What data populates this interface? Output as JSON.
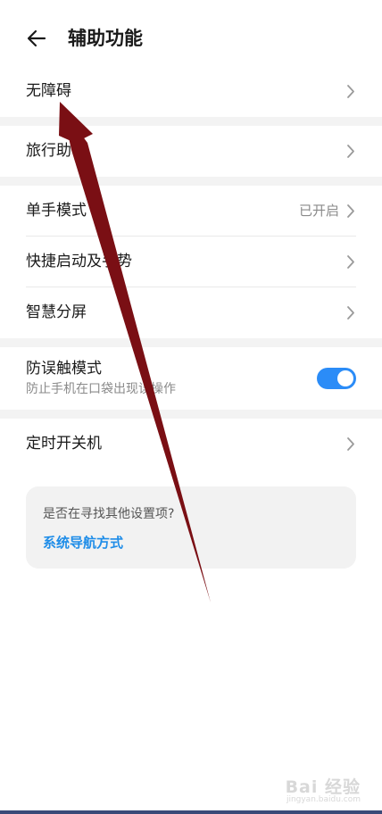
{
  "header": {
    "title": "辅助功能",
    "back_icon": "arrow-left-icon"
  },
  "groups": [
    {
      "items": [
        {
          "label": "无障碍",
          "value": "",
          "control": "chevron"
        }
      ]
    },
    {
      "items": [
        {
          "label": "旅行助手",
          "value": "",
          "control": "chevron"
        }
      ]
    },
    {
      "items": [
        {
          "label": "单手模式",
          "value": "已开启",
          "control": "chevron"
        },
        {
          "label": "快捷启动及手势",
          "value": "",
          "control": "chevron"
        },
        {
          "label": "智慧分屏",
          "value": "",
          "control": "chevron"
        }
      ]
    },
    {
      "items": [
        {
          "label": "防误触模式",
          "sublabel": "防止手机在口袋出现误操作",
          "control": "toggle",
          "enabled": true
        }
      ]
    },
    {
      "items": [
        {
          "label": "定时开关机",
          "value": "",
          "control": "chevron"
        }
      ]
    }
  ],
  "suggestion": {
    "question": "是否在寻找其他设置项?",
    "link": "系统导航方式"
  },
  "watermark": {
    "text": "Bai 经验",
    "url": "jingyan.baidu.com"
  },
  "colors": {
    "accent": "#2b8cf7",
    "link": "#1f8de8",
    "annotation_arrow": "#7a0f14"
  }
}
